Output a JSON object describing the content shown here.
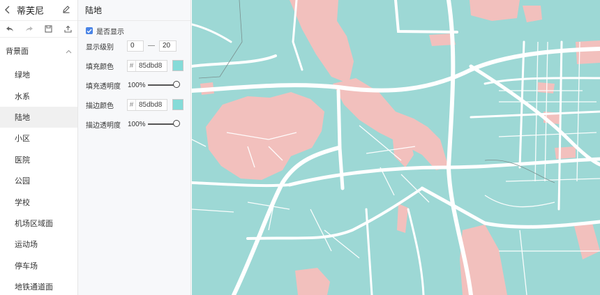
{
  "sidebar": {
    "title": "蒂芙尼",
    "group": {
      "label": "背景面"
    },
    "items": [
      {
        "label": "绿地"
      },
      {
        "label": "水系"
      },
      {
        "label": "陆地"
      },
      {
        "label": "小区"
      },
      {
        "label": "医院"
      },
      {
        "label": "公园"
      },
      {
        "label": "学校"
      },
      {
        "label": "机场区域面"
      },
      {
        "label": "运动场"
      },
      {
        "label": "停车场"
      },
      {
        "label": "地铁通道面"
      }
    ]
  },
  "panel": {
    "title": "陆地",
    "visible_label": "是否显示",
    "visible_checked": true,
    "level_label": "显示级别",
    "level_min": "0",
    "level_sep": "—",
    "level_max": "20",
    "fill_color_label": "填充颜色",
    "fill_color_hash": "#",
    "fill_color_value": "85dbd8",
    "fill_opacity_label": "填充透明度",
    "fill_opacity_value": "100%",
    "stroke_color_label": "描边颜色",
    "stroke_color_hash": "#",
    "stroke_color_value": "85dbd8",
    "stroke_opacity_label": "描边透明度",
    "stroke_opacity_value": "100%"
  },
  "colors": {
    "land": "#9dd8d5",
    "area": "#f2c0bd",
    "road": "#ffffff",
    "swatch": "#85dbd8",
    "accent": "#4a84e6"
  },
  "icons": [
    "back-icon",
    "edit-icon",
    "undo-icon",
    "redo-icon",
    "save-icon",
    "export-icon",
    "chevron-up-icon",
    "check-icon"
  ]
}
